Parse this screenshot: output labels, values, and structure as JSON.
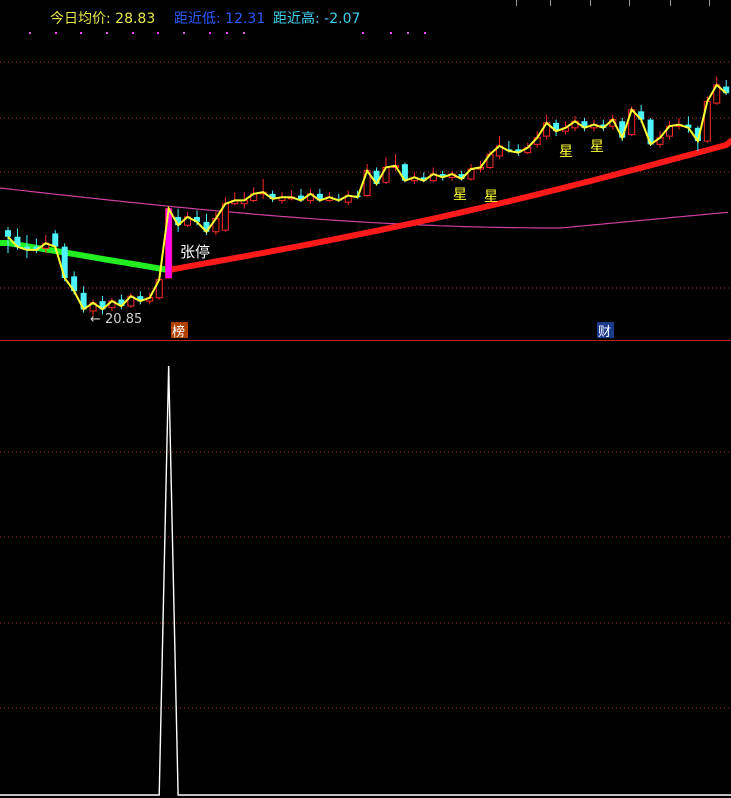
{
  "header": {
    "avg_label": "今日均价:",
    "avg_value": "28.83",
    "low_label": "距近低:",
    "low_value": "12.31",
    "high_label": "距近高:",
    "high_value": "-2.07"
  },
  "colors": {
    "avg": "#e8e84a",
    "low": "#2b5cff",
    "high": "#3fd0f0",
    "up": "#ff2a2a",
    "down": "#4ef5ff",
    "ma_long": "#d03fa0",
    "trend_up": "#ff1a1a",
    "trend_down": "#22ee22",
    "price_line": "#ffff33",
    "dotted": "#b03030",
    "spike": "#ffffff"
  },
  "chart_data": [
    {
      "type": "candlestick",
      "title": "",
      "annotations": [
        {
          "text": "张停",
          "kind": "label"
        },
        {
          "text": "← 20.85",
          "kind": "low-marker"
        },
        {
          "text": "星",
          "kind": "star"
        },
        {
          "text": "星",
          "kind": "star"
        },
        {
          "text": "星",
          "kind": "star"
        },
        {
          "text": "星",
          "kind": "star"
        },
        {
          "text": "榜",
          "kind": "badge"
        },
        {
          "text": "财",
          "kind": "badge"
        }
      ],
      "low_value": 20.85,
      "candles": [
        {
          "o": 23.45,
          "c": 23.25,
          "h": 23.55,
          "l": 22.75,
          "u": false
        },
        {
          "o": 23.25,
          "c": 22.95,
          "h": 23.5,
          "l": 22.85,
          "u": false
        },
        {
          "o": 22.95,
          "c": 22.85,
          "h": 23.3,
          "l": 22.6,
          "u": false
        },
        {
          "o": 22.95,
          "c": 22.85,
          "h": 23.2,
          "l": 22.75,
          "u": false
        },
        {
          "o": 22.9,
          "c": 23.05,
          "h": 23.3,
          "l": 22.75,
          "u": true
        },
        {
          "o": 23.35,
          "c": 22.95,
          "h": 23.45,
          "l": 22.8,
          "u": false
        },
        {
          "o": 22.95,
          "c": 22.0,
          "h": 23.05,
          "l": 21.9,
          "u": false
        },
        {
          "o": 22.05,
          "c": 21.6,
          "h": 22.2,
          "l": 21.5,
          "u": false
        },
        {
          "o": 21.55,
          "c": 21.05,
          "h": 21.75,
          "l": 20.95,
          "u": false
        },
        {
          "o": 21.0,
          "c": 21.25,
          "h": 21.35,
          "l": 20.85,
          "u": true
        },
        {
          "o": 21.3,
          "c": 21.05,
          "h": 21.45,
          "l": 20.9,
          "u": false
        },
        {
          "o": 21.1,
          "c": 21.3,
          "h": 21.4,
          "l": 21.0,
          "u": true
        },
        {
          "o": 21.35,
          "c": 21.15,
          "h": 21.5,
          "l": 21.05,
          "u": false
        },
        {
          "o": 21.15,
          "c": 21.45,
          "h": 21.55,
          "l": 21.1,
          "u": true
        },
        {
          "o": 21.45,
          "c": 21.3,
          "h": 21.6,
          "l": 21.2,
          "u": false
        },
        {
          "o": 21.3,
          "c": 21.4,
          "h": 21.55,
          "l": 21.2,
          "u": true
        },
        {
          "o": 21.4,
          "c": 21.95,
          "h": 22.05,
          "l": 21.35,
          "u": true
        },
        {
          "o": 22.0,
          "c": 24.1,
          "h": 24.15,
          "l": 22.0,
          "u": true
        },
        {
          "o": 23.85,
          "c": 23.6,
          "h": 24.1,
          "l": 23.4,
          "u": false
        },
        {
          "o": 23.6,
          "c": 23.85,
          "h": 24.0,
          "l": 23.55,
          "u": true
        },
        {
          "o": 23.85,
          "c": 23.7,
          "h": 24.05,
          "l": 23.6,
          "u": false
        },
        {
          "o": 23.7,
          "c": 23.4,
          "h": 23.95,
          "l": 23.3,
          "u": false
        },
        {
          "o": 23.4,
          "c": 23.8,
          "h": 24.0,
          "l": 23.3,
          "u": true
        },
        {
          "o": 23.45,
          "c": 24.25,
          "h": 24.45,
          "l": 23.4,
          "u": true
        },
        {
          "o": 24.25,
          "c": 24.35,
          "h": 24.6,
          "l": 24.2,
          "u": true
        },
        {
          "o": 24.25,
          "c": 24.35,
          "h": 24.6,
          "l": 24.1,
          "u": true
        },
        {
          "o": 24.35,
          "c": 24.55,
          "h": 24.75,
          "l": 24.3,
          "u": true
        },
        {
          "o": 24.55,
          "c": 24.6,
          "h": 25.0,
          "l": 24.4,
          "u": true
        },
        {
          "o": 24.55,
          "c": 24.4,
          "h": 24.65,
          "l": 24.3,
          "u": false
        },
        {
          "o": 24.35,
          "c": 24.45,
          "h": 24.6,
          "l": 24.25,
          "u": true
        },
        {
          "o": 24.4,
          "c": 24.45,
          "h": 24.65,
          "l": 24.35,
          "u": true
        },
        {
          "o": 24.5,
          "c": 24.35,
          "h": 24.7,
          "l": 24.3,
          "u": false
        },
        {
          "o": 24.35,
          "c": 24.55,
          "h": 24.7,
          "l": 24.25,
          "u": true
        },
        {
          "o": 24.55,
          "c": 24.35,
          "h": 24.7,
          "l": 24.3,
          "u": false
        },
        {
          "o": 24.35,
          "c": 24.45,
          "h": 24.6,
          "l": 24.3,
          "u": true
        },
        {
          "o": 24.4,
          "c": 24.35,
          "h": 24.55,
          "l": 24.3,
          "u": false
        },
        {
          "o": 24.3,
          "c": 24.5,
          "h": 24.65,
          "l": 24.2,
          "u": true
        },
        {
          "o": 24.5,
          "c": 24.45,
          "h": 24.65,
          "l": 24.4,
          "u": false
        },
        {
          "o": 24.5,
          "c": 25.25,
          "h": 25.45,
          "l": 24.45,
          "u": true
        },
        {
          "o": 25.25,
          "c": 24.85,
          "h": 25.35,
          "l": 24.8,
          "u": false
        },
        {
          "o": 24.9,
          "c": 25.35,
          "h": 25.65,
          "l": 24.85,
          "u": true
        },
        {
          "o": 25.35,
          "c": 25.4,
          "h": 25.75,
          "l": 25.25,
          "u": true
        },
        {
          "o": 25.45,
          "c": 24.95,
          "h": 25.5,
          "l": 24.9,
          "u": false
        },
        {
          "o": 24.95,
          "c": 25.05,
          "h": 25.2,
          "l": 24.85,
          "u": true
        },
        {
          "o": 25.05,
          "c": 24.95,
          "h": 25.2,
          "l": 24.9,
          "u": false
        },
        {
          "o": 24.95,
          "c": 25.15,
          "h": 25.35,
          "l": 24.9,
          "u": true
        },
        {
          "o": 25.15,
          "c": 25.05,
          "h": 25.25,
          "l": 24.95,
          "u": false
        },
        {
          "o": 25.05,
          "c": 25.15,
          "h": 25.25,
          "l": 24.95,
          "u": true
        },
        {
          "o": 25.15,
          "c": 25.0,
          "h": 25.25,
          "l": 24.95,
          "u": false
        },
        {
          "o": 25.0,
          "c": 25.3,
          "h": 25.45,
          "l": 24.95,
          "u": true
        },
        {
          "o": 25.3,
          "c": 25.35,
          "h": 25.55,
          "l": 25.2,
          "u": true
        },
        {
          "o": 25.35,
          "c": 25.75,
          "h": 25.85,
          "l": 25.3,
          "u": true
        },
        {
          "o": 25.7,
          "c": 26.0,
          "h": 26.3,
          "l": 25.6,
          "u": true
        },
        {
          "o": 25.9,
          "c": 25.85,
          "h": 26.15,
          "l": 25.8,
          "u": false
        },
        {
          "o": 25.9,
          "c": 25.8,
          "h": 26.05,
          "l": 25.7,
          "u": false
        },
        {
          "o": 25.8,
          "c": 25.95,
          "h": 26.1,
          "l": 25.75,
          "u": true
        },
        {
          "o": 26.05,
          "c": 26.25,
          "h": 26.45,
          "l": 25.95,
          "u": true
        },
        {
          "o": 26.3,
          "c": 26.7,
          "h": 26.95,
          "l": 26.2,
          "u": true
        },
        {
          "o": 26.7,
          "c": 26.45,
          "h": 26.8,
          "l": 26.3,
          "u": false
        },
        {
          "o": 26.45,
          "c": 26.55,
          "h": 26.75,
          "l": 26.35,
          "u": true
        },
        {
          "o": 26.55,
          "c": 26.75,
          "h": 26.9,
          "l": 26.45,
          "u": true
        },
        {
          "o": 26.75,
          "c": 26.55,
          "h": 26.85,
          "l": 26.45,
          "u": false
        },
        {
          "o": 26.55,
          "c": 26.65,
          "h": 26.8,
          "l": 26.45,
          "u": true
        },
        {
          "o": 26.65,
          "c": 26.55,
          "h": 26.8,
          "l": 26.45,
          "u": false
        },
        {
          "o": 26.6,
          "c": 26.8,
          "h": 26.95,
          "l": 26.5,
          "u": true
        },
        {
          "o": 26.75,
          "c": 26.25,
          "h": 26.85,
          "l": 26.15,
          "u": false
        },
        {
          "o": 26.35,
          "c": 27.1,
          "h": 27.2,
          "l": 26.3,
          "u": true
        },
        {
          "o": 27.05,
          "c": 26.8,
          "h": 27.25,
          "l": 26.7,
          "u": false
        },
        {
          "o": 26.8,
          "c": 26.05,
          "h": 26.85,
          "l": 26.0,
          "u": false
        },
        {
          "o": 26.05,
          "c": 26.25,
          "h": 26.45,
          "l": 25.95,
          "u": true
        },
        {
          "o": 26.3,
          "c": 26.6,
          "h": 26.75,
          "l": 26.2,
          "u": true
        },
        {
          "o": 26.6,
          "c": 26.65,
          "h": 26.85,
          "l": 26.5,
          "u": true
        },
        {
          "o": 26.65,
          "c": 26.55,
          "h": 26.9,
          "l": 26.4,
          "u": false
        },
        {
          "o": 26.55,
          "c": 26.15,
          "h": 26.6,
          "l": 25.85,
          "u": false
        },
        {
          "o": 26.15,
          "c": 27.35,
          "h": 27.5,
          "l": 26.1,
          "u": true
        },
        {
          "o": 27.3,
          "c": 27.85,
          "h": 28.1,
          "l": 27.25,
          "u": true
        },
        {
          "o": 27.8,
          "c": 27.6,
          "h": 28.0,
          "l": 27.55,
          "u": false
        }
      ]
    },
    {
      "type": "line",
      "title": "",
      "series_values": [
        0,
        0,
        0,
        0,
        0,
        0,
        0,
        0,
        0,
        0,
        0,
        0,
        0,
        0,
        0,
        0,
        0,
        1,
        0,
        0,
        0,
        0,
        0,
        0,
        0,
        0,
        0,
        0,
        0,
        0,
        0,
        0,
        0,
        0,
        0,
        0,
        0,
        0,
        0,
        0,
        0,
        0,
        0,
        0,
        0,
        0,
        0,
        0,
        0,
        0,
        0,
        0,
        0,
        0,
        0,
        0,
        0,
        0,
        0,
        0,
        0,
        0,
        0,
        0,
        0,
        0,
        0,
        0,
        0,
        0,
        0,
        0,
        0,
        0,
        0,
        0,
        0
      ],
      "ylim": [
        0,
        1
      ]
    }
  ]
}
